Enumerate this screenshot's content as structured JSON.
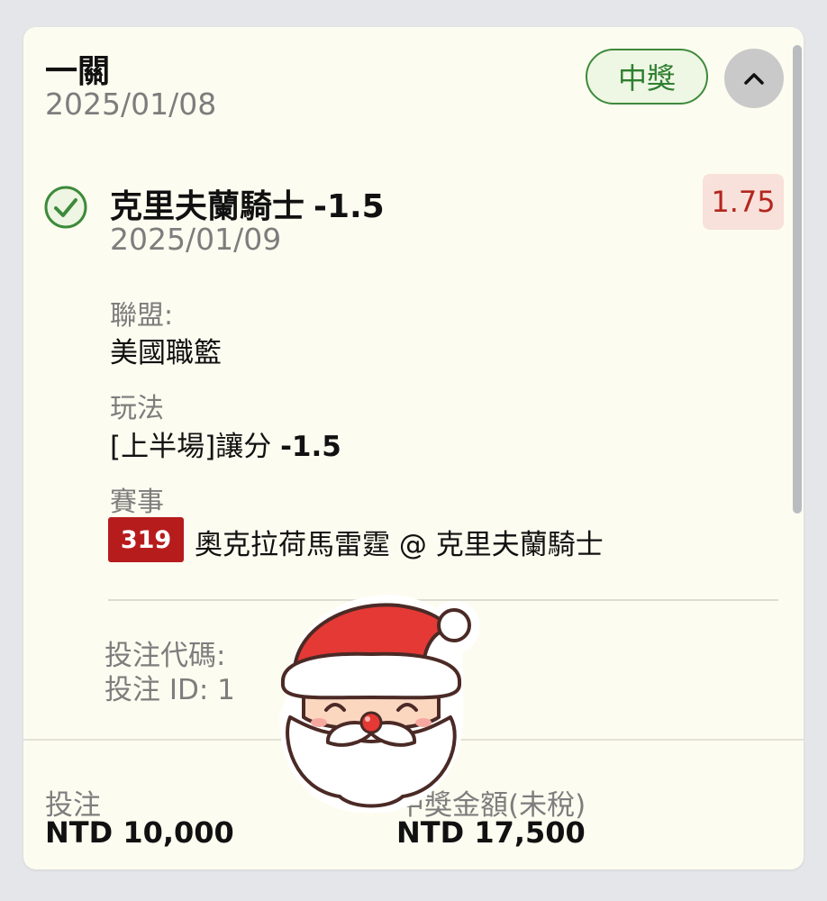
{
  "bet": {
    "title": "一關",
    "date": "2025/01/08",
    "status": "中獎"
  },
  "selection": {
    "team": "克里夫蘭騎士",
    "line": "-1.5",
    "date": "2025/01/09",
    "odds": "1.75",
    "league_label": "聯盟:",
    "league": "美國職籃",
    "play_label": "玩法",
    "play_prefix": "[上半場]讓分",
    "play_line": "-1.5",
    "event_label": "賽事",
    "event_number": "319",
    "event_name": "奧克拉荷馬雷霆 @ 克里夫蘭騎士"
  },
  "codes": {
    "bet_code_label": "投注代碼:",
    "bet_id_label": "投注 ID: 1"
  },
  "footer": {
    "stake_label": "投注",
    "stake_value": "NTD 10,000",
    "payout_label": "中獎金額(未稅)",
    "payout_value": "NTD 17,500"
  },
  "icons": {
    "collapse": "chevron-up-icon",
    "check": "check-circle-icon",
    "sticker": "santa-sticker"
  },
  "colors": {
    "card_bg": "#fdfcf0",
    "win_green": "#3d8a3a",
    "odds_red": "#b3261e",
    "event_badge_red": "#b71c1c"
  }
}
